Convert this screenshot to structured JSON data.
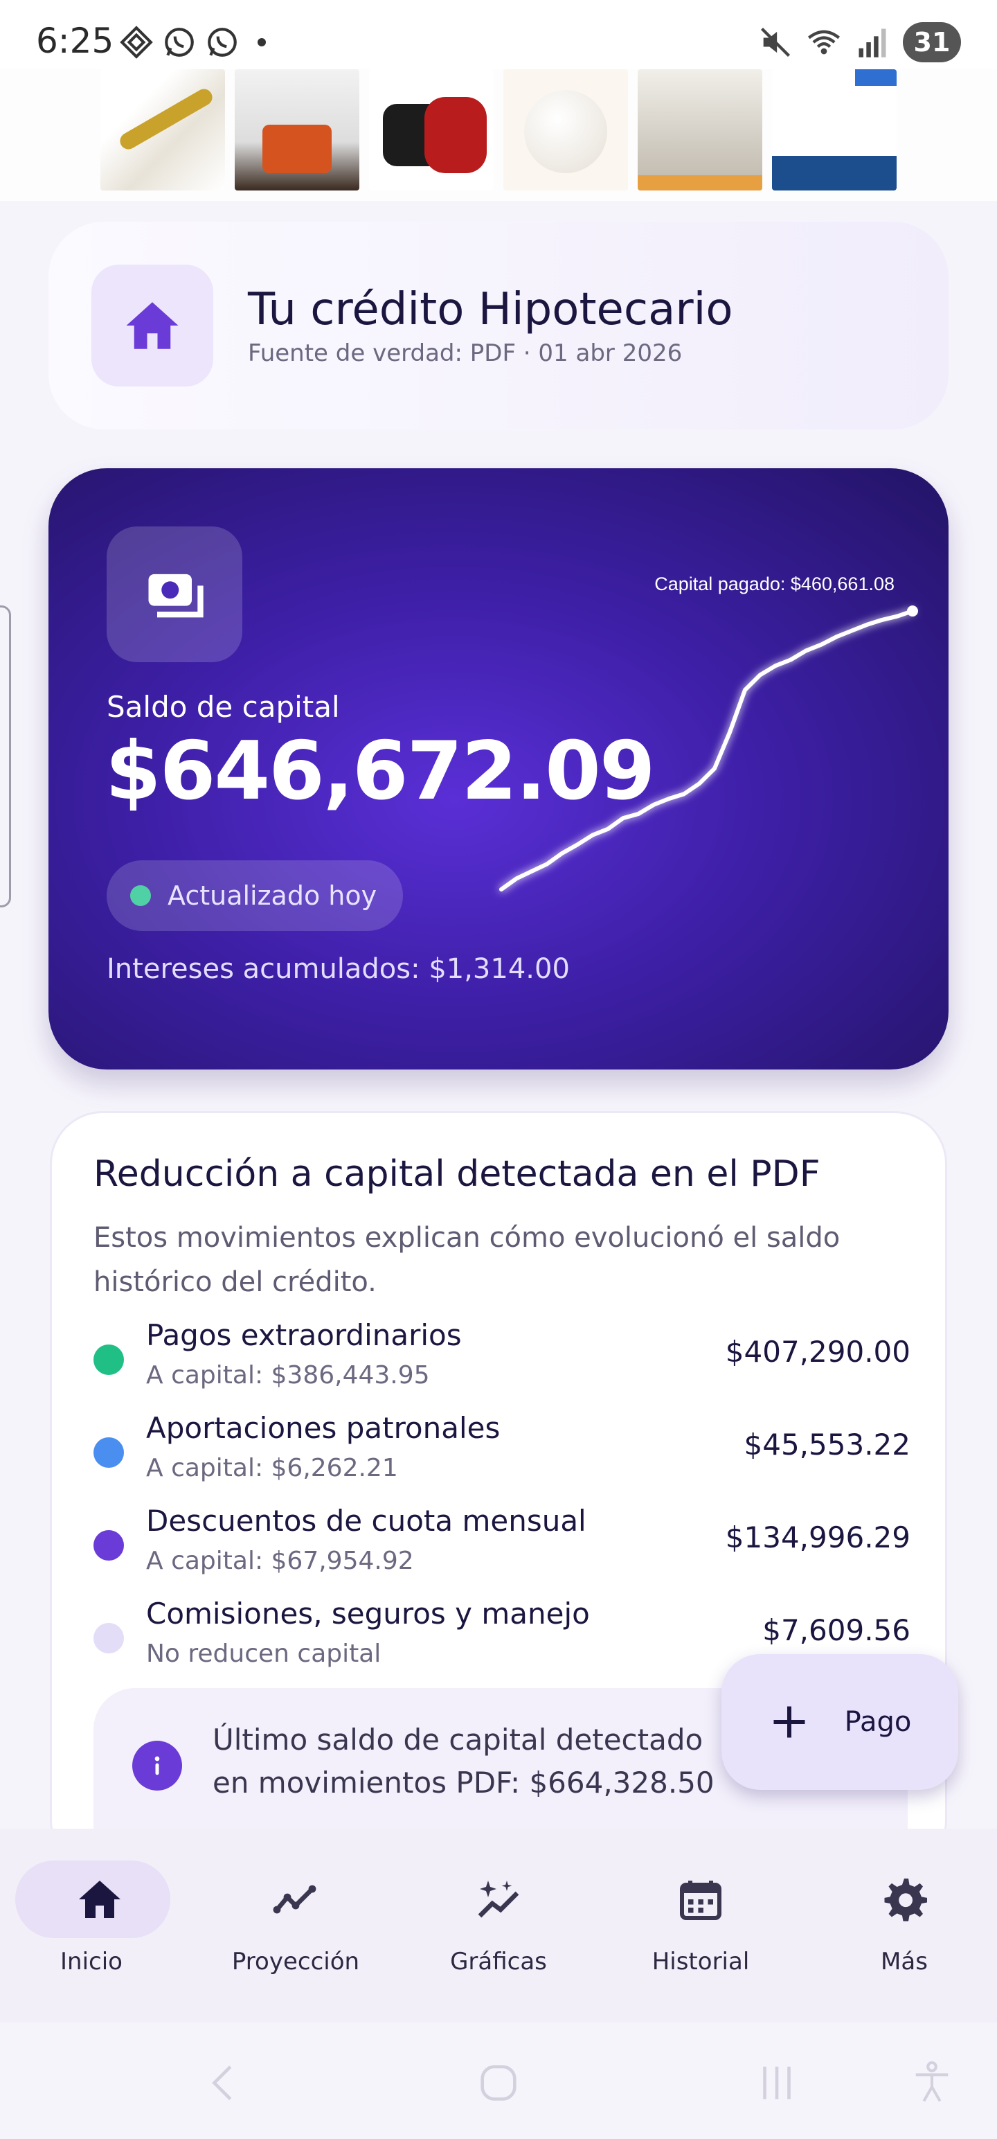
{
  "status_bar": {
    "time": "6:25",
    "battery": "31",
    "icons_left": [
      "grid-app-icon",
      "whatsapp-icon",
      "whatsapp-icon",
      "dot"
    ],
    "icons_right": [
      "mute-icon",
      "wifi-5g-icon",
      "signal-icon",
      "battery-icon"
    ]
  },
  "ad_banner": {
    "items": [
      "ad-product-1",
      "ad-product-2",
      "ad-product-3",
      "ad-product-4",
      "ad-product-5",
      "ad-product-6"
    ]
  },
  "header": {
    "title": "Tu crédito Hipotecario",
    "subtitle": "Fuente de verdad: PDF · 01 abr 2026",
    "icon": "home-icon"
  },
  "hero": {
    "label": "Saldo de capital",
    "value": "$646,672.09",
    "status": "Actualizado hoy",
    "interest": "Intereses acumulados: $1,314.00",
    "chart_label": "Capital pagado: $460,661.08",
    "colors": {
      "status_dot": "#4fd1a5"
    },
    "icon": "money-icon"
  },
  "chart_data": {
    "type": "line",
    "title": "",
    "xlabel": "",
    "ylabel": "",
    "annotation": "Capital pagado: $460,661.08",
    "series": [
      {
        "values": [
          0,
          18000,
          30000,
          42000,
          60000,
          74000,
          90000,
          100000,
          118000,
          125000,
          140000,
          150000,
          158000,
          175000,
          200000,
          260000,
          330000,
          355000,
          370000,
          380000,
          395000,
          405000,
          418000,
          428000,
          438000,
          446000,
          452000,
          460661.08
        ]
      }
    ],
    "ylim": [
      0,
      470000
    ],
    "grid": false,
    "legend": "none"
  },
  "reduction": {
    "title": "Reducción a capital detectada en el PDF",
    "description": "Estos movimientos explican cómo evolucionó el saldo histórico del crédito.",
    "items": [
      {
        "name": "Pagos extraordinarios",
        "sub": "A capital: $386,443.95",
        "amount": "$407,290.00",
        "color": "#1fbf86"
      },
      {
        "name": "Aportaciones patronales",
        "sub": "A capital: $6,262.21",
        "amount": "$45,553.22",
        "color": "#4a8ef0"
      },
      {
        "name": "Descuentos de cuota mensual",
        "sub": "A capital: $67,954.92",
        "amount": "$134,996.29",
        "color": "#6a3bd7"
      },
      {
        "name": "Comisiones, seguros y manejo",
        "sub": "No reducen capital",
        "amount": "$7,609.56",
        "color": "#e4ddf7"
      }
    ],
    "info": "Último saldo de capital detectado en movimientos PDF: $664,328.50"
  },
  "fab": {
    "label": "Pago",
    "icon": "plus-icon"
  },
  "bottom_nav": {
    "items": [
      {
        "label": "Inicio",
        "icon": "home-icon",
        "active": true
      },
      {
        "label": "Proyección",
        "icon": "trend-icon",
        "active": false
      },
      {
        "label": "Gráficas",
        "icon": "sparkle-chart-icon",
        "active": false
      },
      {
        "label": "Historial",
        "icon": "calendar-icon",
        "active": false
      },
      {
        "label": "Más",
        "icon": "gear-icon",
        "active": false
      }
    ]
  },
  "system_nav": [
    "back-icon",
    "home-circle-icon",
    "recents-icon",
    "accessibility-icon"
  ]
}
